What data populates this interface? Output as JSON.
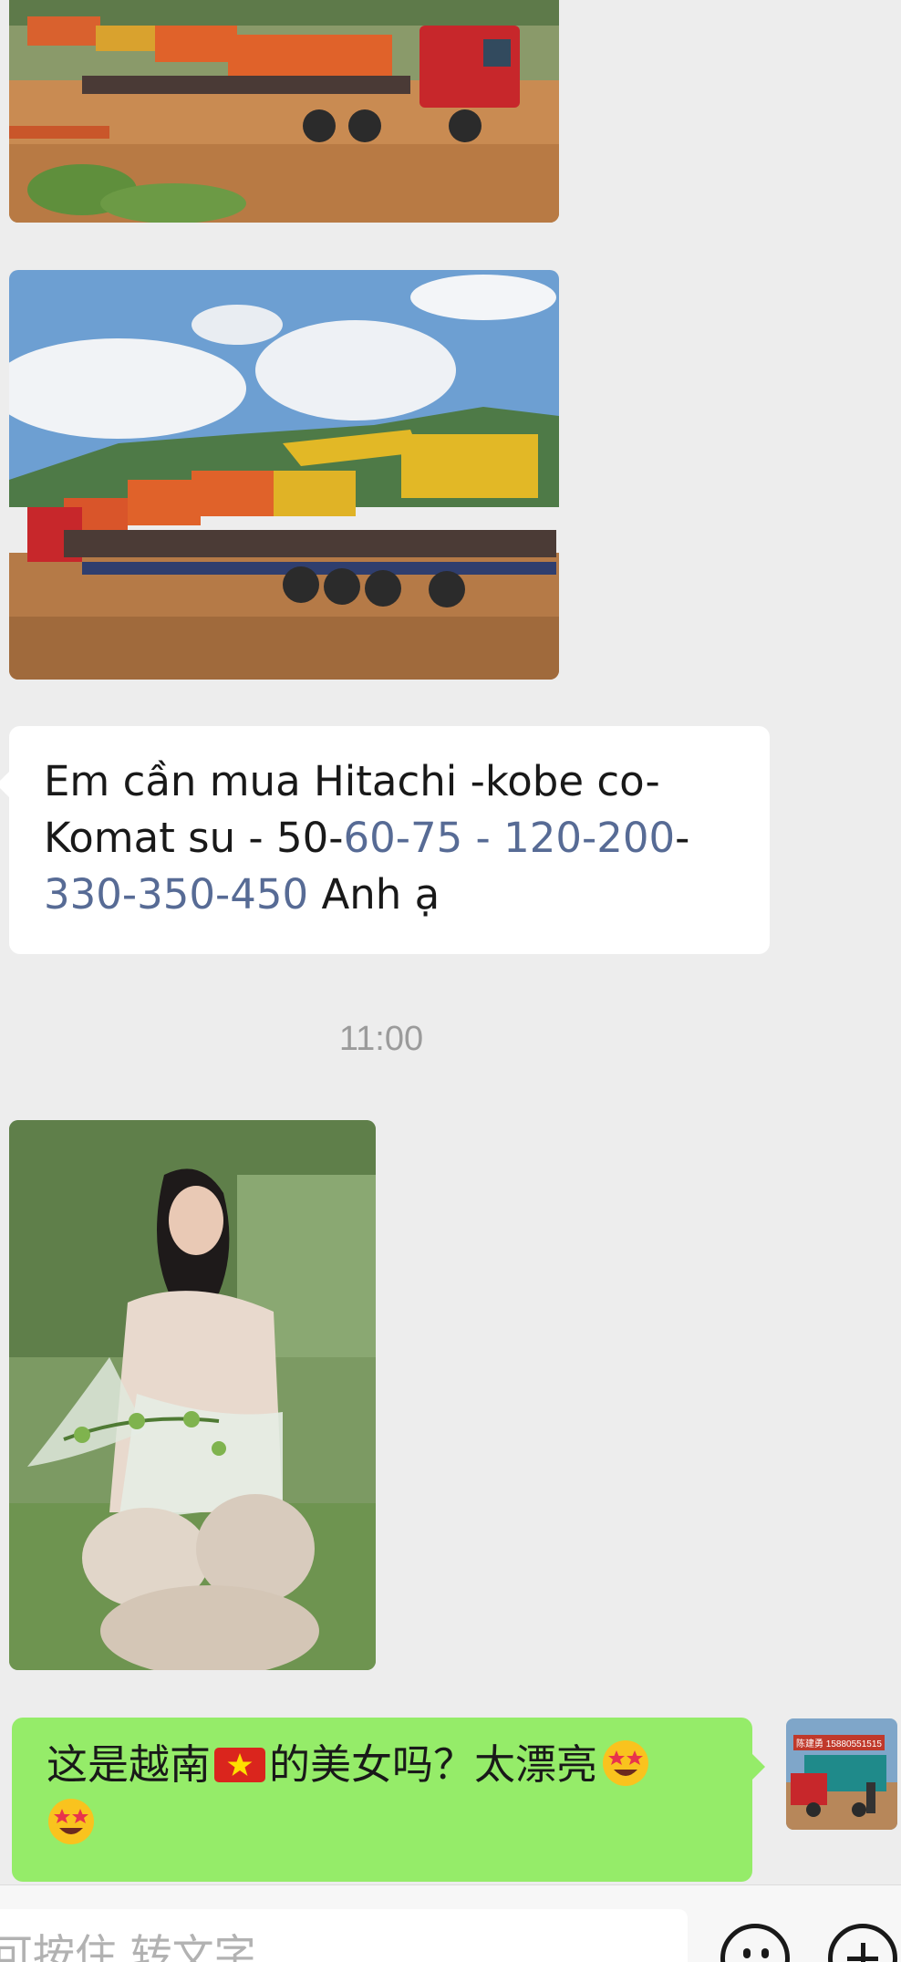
{
  "messages": {
    "incoming_text": {
      "line1": "Em cần mua Hitachi -kobe co-",
      "line2_prefix": "Komat su - 50-",
      "line2_link": "60-75 - 120-200",
      "line2_suffix": "-",
      "line3_link": "330-350-450",
      "line3_suffix": " Anh ạ"
    },
    "timestamp": "11:00",
    "outgoing_text": {
      "part1": "这是越南",
      "part2": "的美女吗？太漂亮"
    },
    "avatar_caption": "陈建勇 15880551515"
  },
  "input": {
    "placeholder": "可按住 转文字"
  },
  "icons": {
    "flag": "vietnam-flag-icon",
    "emoji": "star-struck-face-icon",
    "emoji_button": "emoji-icon",
    "more_button": "plus-icon"
  },
  "colors": {
    "background": "#ededed",
    "outgoing_bubble": "#95ec69",
    "incoming_bubble": "#ffffff",
    "link": "#576b95",
    "timestamp": "#9b9b9b"
  }
}
